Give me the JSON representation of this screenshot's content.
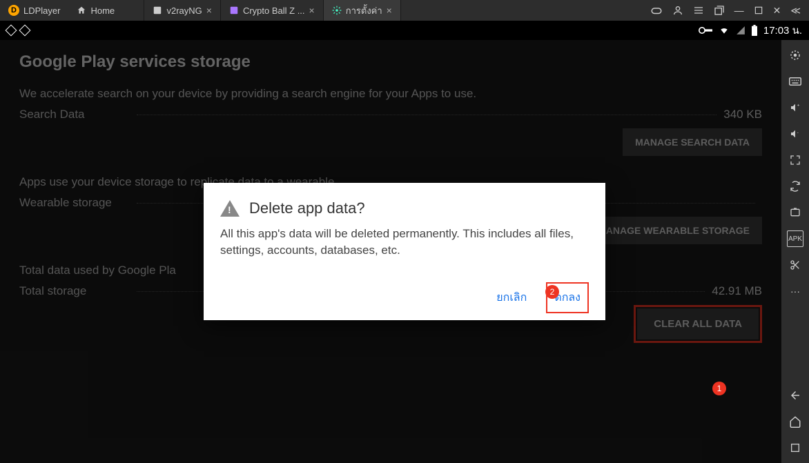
{
  "app": {
    "name": "LDPlayer"
  },
  "tabs": [
    {
      "label": "Home",
      "icon": "home"
    },
    {
      "label": "v2rayNG",
      "icon": "app",
      "closable": true
    },
    {
      "label": "Crypto Ball Z ...",
      "icon": "app",
      "closable": true
    },
    {
      "label": "การตั้งค่า",
      "icon": "gear",
      "closable": true,
      "active": true
    }
  ],
  "status": {
    "time": "17:03 น."
  },
  "page": {
    "title": "Google Play services storage",
    "search_desc": "We accelerate search on your device by providing a search engine for your Apps to use.",
    "search_label": "Search Data",
    "search_value": "340 KB",
    "manage_search_btn": "MANAGE SEARCH DATA",
    "wearable_desc": "Apps use your device storage to replicate data to a wearable.",
    "wearable_label": "Wearable storage",
    "manage_wearable_btn": "MANAGE WEARABLE STORAGE",
    "total_desc": "Total data used by Google Pla",
    "total_label": "Total storage",
    "total_value": "42.91 MB",
    "clear_btn": "CLEAR ALL DATA"
  },
  "dialog": {
    "title": "Delete app data?",
    "body": "All this app's data will be deleted permanently. This includes all files, settings, accounts, databases, etc.",
    "cancel": "ยกเลิก",
    "ok": "ตกลง"
  },
  "annotations": {
    "step1": "1",
    "step2": "2"
  }
}
